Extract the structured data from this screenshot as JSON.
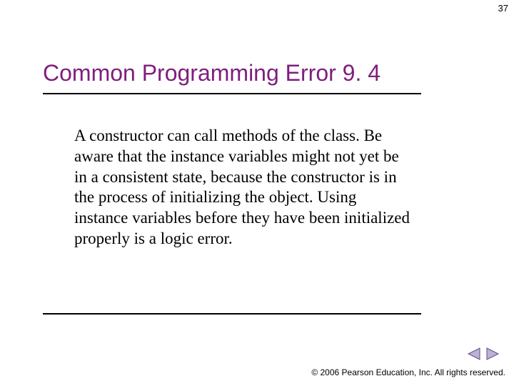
{
  "page_number": "37",
  "title": "Common Programming Error 9. 4",
  "body": "A constructor can call methods of the class. Be aware that the instance variables might not yet be in a consistent state, because the constructor is in the process of initializing the object. Using instance variables before they have been initialized properly is a logic error.",
  "copyright": "© 2006 Pearson Education, Inc.  All rights reserved."
}
